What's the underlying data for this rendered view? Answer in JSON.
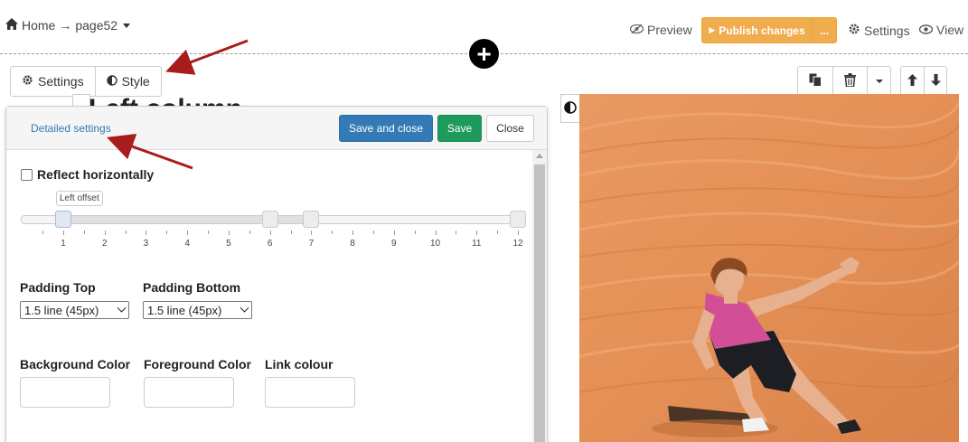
{
  "breadcrumb": {
    "home": "Home",
    "separator": "→",
    "page": "page52"
  },
  "header": {
    "preview": "Preview",
    "publish": "Publish changes",
    "publish_more": "...",
    "settings": "Settings",
    "view": "View"
  },
  "tabs": [
    {
      "label": "Settings"
    },
    {
      "label": "Style"
    }
  ],
  "background_heading": "Left column",
  "panel": {
    "detailed_settings": "Detailed settings",
    "save_and_close": "Save and close",
    "save": "Save",
    "close": "Close",
    "reflect_label": "Reflect horizontally",
    "reflect_checked": false,
    "slider": {
      "tooltip": "Left offset",
      "ticks": [
        "1",
        "2",
        "3",
        "4",
        "5",
        "6",
        "7",
        "8",
        "9",
        "10",
        "11",
        "12"
      ],
      "handles": [
        1,
        6,
        7,
        12
      ]
    },
    "padding_top": {
      "label": "Padding Top",
      "value": "1.5 line (45px)"
    },
    "padding_bottom": {
      "label": "Padding Bottom",
      "value": "1.5 line (45px)"
    },
    "background_color": {
      "label": "Background Color",
      "value": ""
    },
    "foreground_color": {
      "label": "Foreground Color",
      "value": ""
    },
    "link_colour": {
      "label": "Link colour",
      "value": ""
    }
  },
  "icons": {
    "home": "home-icon",
    "preview": "eye-slash-icon",
    "settings": "gear-icon",
    "view": "eye-icon",
    "style": "contrast-icon",
    "copy": "copy-icon",
    "delete": "trash-icon",
    "dropdown": "caret-down-icon",
    "up": "arrow-up-icon",
    "down": "arrow-down-icon",
    "add": "plus-icon"
  },
  "colors": {
    "publish": "#f0ad4e",
    "primary": "#337ab7",
    "success": "#1e9a5c",
    "annotation_arrow": "#a81c1c"
  }
}
